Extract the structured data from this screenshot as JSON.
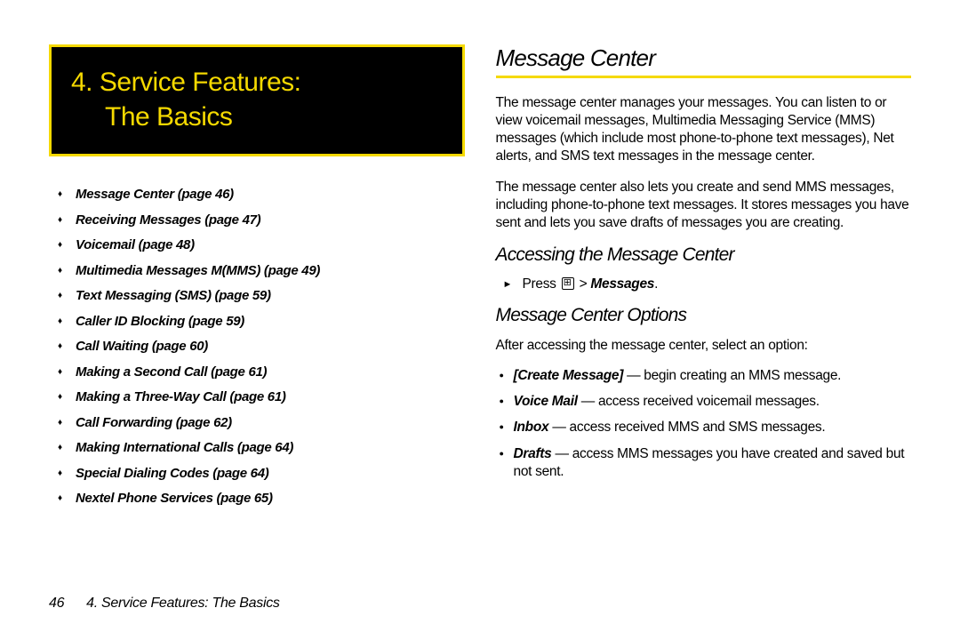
{
  "chapter": {
    "number": "4.",
    "line1": "Service Features:",
    "line2": "The Basics"
  },
  "toc": [
    "Message Center (page 46)",
    "Receiving Messages (page 47)",
    "Voicemail (page 48)",
    "Multimedia Messages M(MMS) (page 49)",
    "Text Messaging (SMS) (page 59)",
    "Caller ID Blocking (page 59)",
    "Call Waiting (page 60)",
    "Making a Second Call (page 61)",
    "Making a Three-Way Call (page 61)",
    "Call Forwarding (page 62)",
    "Making International Calls (page 64)",
    "Special Dialing Codes (page 64)",
    "Nextel Phone Services (page 65)"
  ],
  "right": {
    "title": "Message Center",
    "para1": "The message center manages your messages. You can listen to or view voicemail messages, Multimedia Messaging Service (MMS) messages (which include most phone-to-phone text messages), Net alerts, and SMS text messages in the message center.",
    "para2": "The message center also lets you create and send MMS messages, including phone-to-phone text messages. It stores messages you have sent and lets you save drafts of messages you are creating.",
    "sub1": "Accessing the Message Center",
    "step_press": "Press ",
    "step_gt": " > ",
    "step_target": "Messages",
    "step_end": ".",
    "sub2": "Message Center Options",
    "intro": "After accessing the message center, select an option:",
    "options": [
      {
        "label": "[Create Message]",
        "desc": " — begin creating an MMS message."
      },
      {
        "label": "Voice Mail",
        "desc": " — access received voicemail messages."
      },
      {
        "label": "Inbox",
        "desc": " — access received MMS and SMS messages."
      },
      {
        "label": "Drafts",
        "desc": " — access MMS messages you have created and saved but not sent."
      }
    ]
  },
  "footer": {
    "page_number": "46",
    "label": "4. Service Features: The Basics"
  }
}
